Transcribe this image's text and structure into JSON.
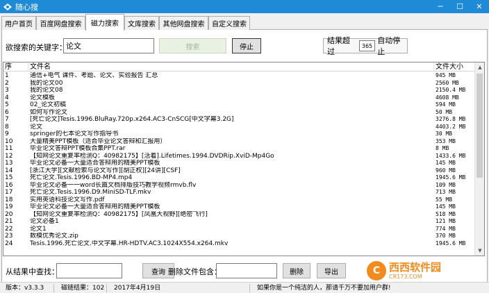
{
  "window": {
    "title": "随心搜",
    "min": "─",
    "max": "☐",
    "close": "✕"
  },
  "tabs": [
    {
      "label": "用户首页",
      "active": false
    },
    {
      "label": "百度网盘搜索",
      "active": false
    },
    {
      "label": "磁力搜索",
      "active": true
    },
    {
      "label": "文库搜索",
      "active": false
    },
    {
      "label": "其他网盘搜索",
      "active": false
    },
    {
      "label": "自定义搜索",
      "active": false
    }
  ],
  "search": {
    "label": "欲搜索的关键字：",
    "value": "论文",
    "search_button": "搜索",
    "stop_button": "停止",
    "result_prefix": "结果超过",
    "result_count": "365",
    "result_suffix": "自动停止"
  },
  "list": {
    "columns": {
      "no": "序",
      "name": "文件名",
      "size": "文件大小"
    },
    "rows": [
      {
        "no": "1",
        "name": "通信+电气 课件、考题、论文、实验报告 汇总",
        "size": "945 MB"
      },
      {
        "no": "2",
        "name": "我的论文00",
        "size": "2560 MB"
      },
      {
        "no": "3",
        "name": "我的论文08",
        "size": "2150.4 MB"
      },
      {
        "no": "4",
        "name": "论文模板",
        "size": "4608 MB"
      },
      {
        "no": "5",
        "name": "02_论文初稿",
        "size": "594 MB"
      },
      {
        "no": "6",
        "name": "如何写作论文",
        "size": "50 MB"
      },
      {
        "no": "7",
        "name": "[死亡论文]Tesis.1996.BluRay.720p.x264.AC3-CnSCG[中文字幕3.2G]",
        "size": "3276.8 MB"
      },
      {
        "no": "8",
        "name": "论文",
        "size": "4403.2 MB"
      },
      {
        "no": "9",
        "name": "springer的七本论文写作指导书",
        "size": "30 MB"
      },
      {
        "no": "10",
        "name": "大量精美PPT模板（适合毕业论文答辩和汇报用）",
        "size": "353 MB"
      },
      {
        "no": "11",
        "name": "毕业论文答辩PPT模板合集PPT.rar",
        "size": "8 MB"
      },
      {
        "no": "12",
        "name": "【知网论文重复率检测Q：40982175】[活着].Lifetimes.1994.DVDRip.XviD-Mp4Go",
        "size": "1433.6 MB"
      },
      {
        "no": "13",
        "name": "毕业论文必备一大量适合答辩用的精美PPT模板",
        "size": "145 MB"
      },
      {
        "no": "14",
        "name": "[浙江大学][文献检索与论文写作][胡正权][24讲][CSF]",
        "size": "960 MB"
      },
      {
        "no": "15",
        "name": "死亡论文.Tesis.1996.BD-MP4.mp4",
        "size": "1945.6 MB"
      },
      {
        "no": "16",
        "name": "毕业论文必备一一word长篇文档排版技巧教学视频rmvb.flv",
        "size": "109 MB"
      },
      {
        "no": "17",
        "name": "死亡论文.Tesis.1996.D9.MiniSD-TLF.mkv",
        "size": "713 MB"
      },
      {
        "no": "18",
        "name": "实用英语科技论文写作.pdf",
        "size": "55 MB"
      },
      {
        "no": "19",
        "name": "毕业论文必备一大量适合答辩用的精美PPT模板",
        "size": "145 MB"
      },
      {
        "no": "20",
        "name": "【知网论文重复率检测Q：40982175】[凤凰大视野][绝密飞行]",
        "size": "518 MB"
      },
      {
        "no": "21",
        "name": "论文必备1",
        "size": "121 MB"
      },
      {
        "no": "22",
        "name": "论文1",
        "size": "774 MB"
      },
      {
        "no": "23",
        "name": "数模优秀论文.zip",
        "size": "370 MB"
      },
      {
        "no": "24",
        "name": "Tesis.1996.死亡论文.中文字幕.HR-HDTV.AC3.1024X554.x264.mkv",
        "size": "1945.6 MB"
      }
    ]
  },
  "filter": {
    "find_label": "从结果中查找：",
    "find_value": "",
    "query_button": "查询",
    "exclude_label": "删除文件包含：",
    "exclude_value": "",
    "delete_button": "删除",
    "export_button": "导出"
  },
  "status": {
    "version": "版本：v3.3.3",
    "results": "磁链结果：102",
    "date": "2017年4月19日",
    "message": "如果你是一个纯洁的人，那请千万不要加用户群!"
  },
  "watermark": {
    "logo": "C",
    "name": "西西软件园",
    "url": "CR173.COM"
  }
}
